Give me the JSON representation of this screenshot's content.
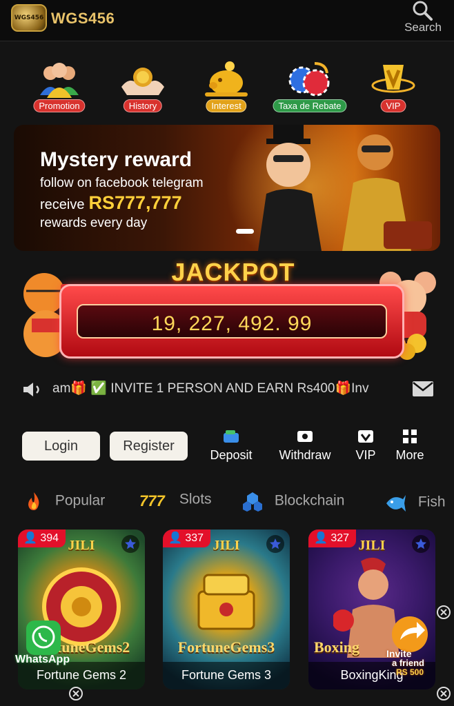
{
  "header": {
    "logo_text": "WGS456",
    "brand": "WGS456",
    "search_label": "Search"
  },
  "quick_links": [
    {
      "label": "Promotion",
      "icon": "people-icon",
      "color": "#d8322e"
    },
    {
      "label": "History",
      "icon": "coin-hands-icon",
      "color": "#d8322e"
    },
    {
      "label": "Interest",
      "icon": "piggy-bank-icon",
      "color": "#e2a21a"
    },
    {
      "label": "Taxa de Rebate",
      "icon": "chips-icon",
      "color": "#2e9a48"
    },
    {
      "label": "VIP",
      "icon": "vip-crown-icon",
      "color": "#d8322e"
    }
  ],
  "banner": {
    "title": "Mystery reward",
    "line2": "follow on facebook telegram",
    "line3_prefix": "receive",
    "line3_amount": "RS777,777",
    "line4": "rewards every day"
  },
  "jackpot": {
    "title": "JACKPOT",
    "value": "19, 227, 492. 99"
  },
  "marquee": {
    "text": "am🎁 ✅ INVITE 1 PERSON AND EARN Rs400🎁Inv"
  },
  "actions": {
    "login": "Login",
    "register": "Register",
    "deposit": "Deposit",
    "withdraw": "Withdraw",
    "vip": "VIP",
    "more": "More"
  },
  "categories": [
    {
      "label": "Popular",
      "icon": "flame-icon"
    },
    {
      "label": "Slots",
      "icon": "slot-777-icon"
    },
    {
      "label": "Blockchain",
      "icon": "blockchain-icon"
    },
    {
      "label": "Fish",
      "icon": "fish-icon"
    }
  ],
  "games": [
    {
      "players": "394",
      "brand": "JILI",
      "logo": "FortuneGems2",
      "name": "Fortune Gems 2"
    },
    {
      "players": "337",
      "brand": "JILI",
      "logo": "FortuneGems3",
      "name": "Fortune Gems 3"
    },
    {
      "players": "327",
      "brand": "JILI",
      "logo": "Boxing",
      "name": "BoxingKing"
    }
  ],
  "floating": {
    "whatsapp": "WhatsApp",
    "invite_line1": "Invite",
    "invite_line2": "a friend",
    "invite_amount": "RS 500"
  }
}
